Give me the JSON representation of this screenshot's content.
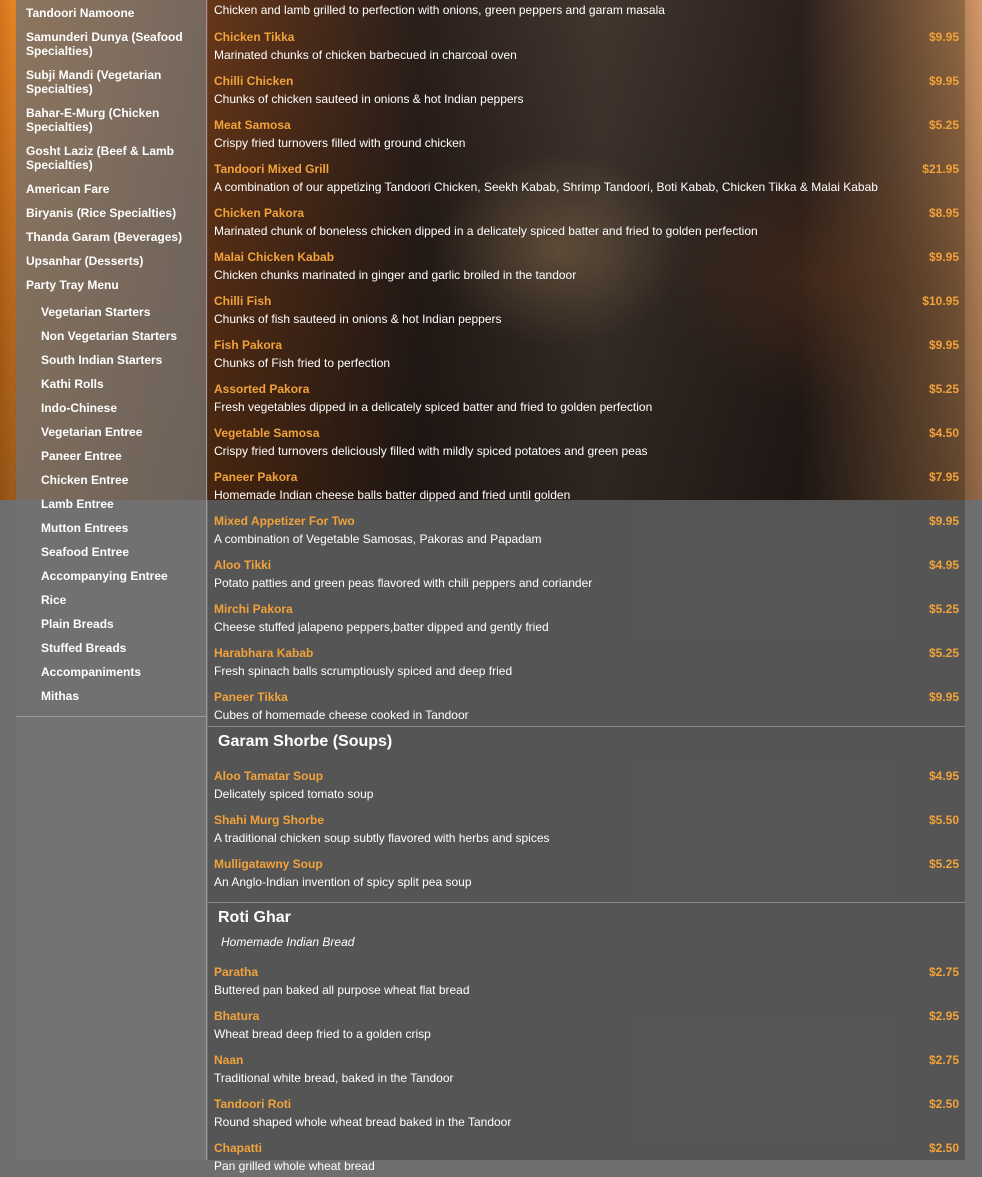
{
  "sidebar": {
    "categories": [
      {
        "label": "Tandoori Namoone"
      },
      {
        "label": "Samunderi Dunya (Seafood Specialties)"
      },
      {
        "label": "Subji Mandi (Vegetarian Specialties)"
      },
      {
        "label": "Bahar-E-Murg (Chicken Specialties)"
      },
      {
        "label": "Gosht Laziz (Beef & Lamb Specialties)"
      },
      {
        "label": "American Fare"
      },
      {
        "label": "Biryanis (Rice Specialties)"
      },
      {
        "label": "Thanda Garam (Beverages)"
      },
      {
        "label": "Upsanhar (Desserts)"
      },
      {
        "label": "Party Tray Menu"
      }
    ],
    "subitems": [
      {
        "label": "Vegetarian Starters"
      },
      {
        "label": "Non Vegetarian Starters"
      },
      {
        "label": "South Indian Starters"
      },
      {
        "label": "Kathi Rolls"
      },
      {
        "label": "Indo-Chinese"
      },
      {
        "label": "Vegetarian Entree"
      },
      {
        "label": "Paneer Entree"
      },
      {
        "label": "Chicken Entree"
      },
      {
        "label": "Lamb Entree"
      },
      {
        "label": "Mutton Entrees"
      },
      {
        "label": "Seafood Entree"
      },
      {
        "label": "Accompanying Entree"
      },
      {
        "label": "Rice"
      },
      {
        "label": "Plain Breads"
      },
      {
        "label": "Stuffed Breads"
      },
      {
        "label": "Accompaniments"
      },
      {
        "label": "Mithas"
      }
    ]
  },
  "menu": {
    "top_desc": "Chicken and lamb grilled to perfection with onions, green peppers and garam masala",
    "appetizers": [
      {
        "name": "Chicken Tikka",
        "price": "$9.95",
        "desc": "Marinated chunks of chicken barbecued in charcoal oven"
      },
      {
        "name": "Chilli Chicken",
        "price": "$9.95",
        "desc": "Chunks of chicken sauteed in onions & hot Indian peppers"
      },
      {
        "name": "Meat Samosa",
        "price": "$5.25",
        "desc": "Crispy fried turnovers filled with ground chicken"
      },
      {
        "name": "Tandoori Mixed Grill",
        "price": "$21.95",
        "desc": "A combination of our appetizing Tandoori Chicken, Seekh Kabab, Shrimp Tandoori, Boti Kabab, Chicken Tikka & Malai Kabab"
      },
      {
        "name": "Chicken Pakora",
        "price": "$8.95",
        "desc": "Marinated chunk of boneless chicken dipped in a delicately spiced batter and fried to golden perfection"
      },
      {
        "name": "Malai Chicken Kabab",
        "price": "$9.95",
        "desc": "Chicken chunks marinated in ginger and garlic broiled in the tandoor"
      },
      {
        "name": "Chilli Fish",
        "price": "$10.95",
        "desc": "Chunks of fish sauteed in onions & hot Indian peppers"
      },
      {
        "name": "Fish Pakora",
        "price": "$9.95",
        "desc": "Chunks of Fish fried to perfection"
      },
      {
        "name": "Assorted Pakora",
        "price": "$5.25",
        "desc": "Fresh vegetables dipped in a delicately spiced batter and fried to golden perfection"
      },
      {
        "name": "Vegetable Samosa",
        "price": "$4.50",
        "desc": "Crispy fried turnovers deliciously filled with mildly spiced potatoes and green peas"
      },
      {
        "name": "Paneer Pakora",
        "price": "$7.95",
        "desc": "Homemade Indian cheese balls batter dipped and fried until golden"
      },
      {
        "name": "Mixed Appetizer For Two",
        "price": "$9.95",
        "desc": "A combination of Vegetable Samosas, Pakoras and Papadam"
      },
      {
        "name": "Aloo Tikki",
        "price": "$4.95",
        "desc": "Potato patties and green peas flavored with chili peppers and coriander"
      },
      {
        "name": "Mirchi Pakora",
        "price": "$5.25",
        "desc": "Cheese stuffed jalapeno peppers,batter dipped and gently fried"
      },
      {
        "name": "Harabhara Kabab",
        "price": "$5.25",
        "desc": "Fresh spinach balls scrumptiously spiced and deep fried"
      },
      {
        "name": "Paneer Tikka",
        "price": "$9.95",
        "desc": "Cubes of homemade cheese cooked in Tandoor"
      }
    ],
    "soups": {
      "title": "Garam Shorbe (Soups)",
      "items": [
        {
          "name": "Aloo Tamatar Soup",
          "price": "$4.95",
          "desc": "Delicately spiced tomato soup"
        },
        {
          "name": "Shahi Murg Shorbe",
          "price": "$5.50",
          "desc": "A traditional chicken soup subtly flavored with herbs and spices"
        },
        {
          "name": "Mulligatawny Soup",
          "price": "$5.25",
          "desc": "An Anglo-Indian invention of spicy split pea soup"
        }
      ]
    },
    "breads": {
      "title": "Roti Ghar",
      "subtitle": "Homemade Indian Bread",
      "items": [
        {
          "name": "Paratha",
          "price": "$2.75",
          "desc": "Buttered pan baked all purpose wheat flat bread"
        },
        {
          "name": "Bhatura",
          "price": "$2.95",
          "desc": "Wheat bread deep fried to a golden crisp"
        },
        {
          "name": "Naan",
          "price": "$2.75",
          "desc": "Traditional white bread, baked in the Tandoor"
        },
        {
          "name": "Tandoori Roti",
          "price": "$2.50",
          "desc": "Round shaped whole wheat bread baked in the Tandoor"
        },
        {
          "name": "Chapatti",
          "price": "$2.50",
          "desc": "Pan grilled whole wheat bread"
        }
      ]
    }
  }
}
